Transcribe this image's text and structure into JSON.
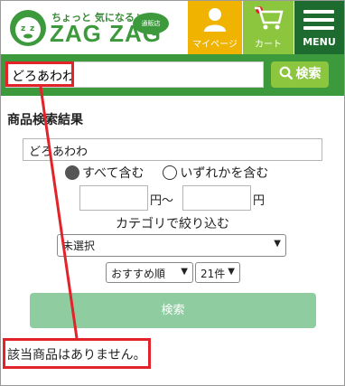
{
  "header": {
    "tagline": "ちょっと 気になる♪",
    "logo_text": "ZAG ZAG",
    "store_label": "通販店",
    "mypage_label": "マイページ",
    "cart_label": "カート",
    "menu_label": "MENU"
  },
  "search": {
    "value": "どろあわわ",
    "button_label": "検索"
  },
  "results": {
    "title": "商品検索結果",
    "keyword": "どろあわわ",
    "radio_all": "すべて含む",
    "radio_any": "いずれかを含む",
    "price_unit_from": "円〜",
    "price_unit_to": "円",
    "category_label": "カテゴリで絞り込む",
    "category_selected": "未選択",
    "sort_selected": "おすすめ順",
    "per_page_selected": "21件",
    "submit_label": "検索",
    "no_result_text": "該当商品はありません。"
  },
  "colors": {
    "brand_green": "#3c9a3c",
    "mypage_yellow": "#f0b400",
    "cart_green": "#8cc63f",
    "menu_dark_green": "#1d6b2e",
    "annotation_red": "#e2232a"
  }
}
